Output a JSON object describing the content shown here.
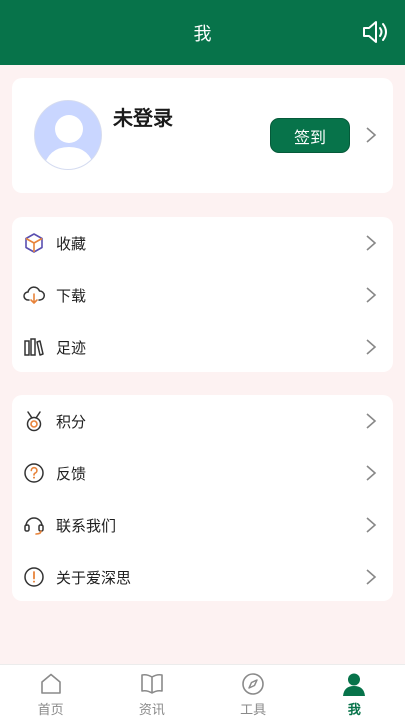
{
  "header": {
    "title": "我",
    "sound_icon": "speaker-icon"
  },
  "profile": {
    "username": "未登录",
    "checkin_label": "签到",
    "avatar_icon": "default-user-avatar"
  },
  "menu_group_1": [
    {
      "label": "收藏",
      "icon": "cube-icon"
    },
    {
      "label": "下载",
      "icon": "cloud-download-icon"
    },
    {
      "label": "足迹",
      "icon": "books-icon"
    }
  ],
  "menu_group_2": [
    {
      "label": "积分",
      "icon": "medal-icon"
    },
    {
      "label": "反馈",
      "icon": "question-circle-icon"
    },
    {
      "label": "联系我们",
      "icon": "headset-icon"
    },
    {
      "label": "关于爱深思",
      "icon": "info-circle-icon"
    }
  ],
  "tabbar": [
    {
      "label": "首页",
      "icon": "home-icon",
      "active": false
    },
    {
      "label": "资讯",
      "icon": "book-open-icon",
      "active": false
    },
    {
      "label": "工具",
      "icon": "compass-icon",
      "active": false
    },
    {
      "label": "我",
      "icon": "user-icon",
      "active": true
    }
  ],
  "colors": {
    "primary": "#07734a",
    "background": "#fdf2f2",
    "icon_accent": "#e8833a",
    "icon_purple": "#5a4fb0"
  }
}
